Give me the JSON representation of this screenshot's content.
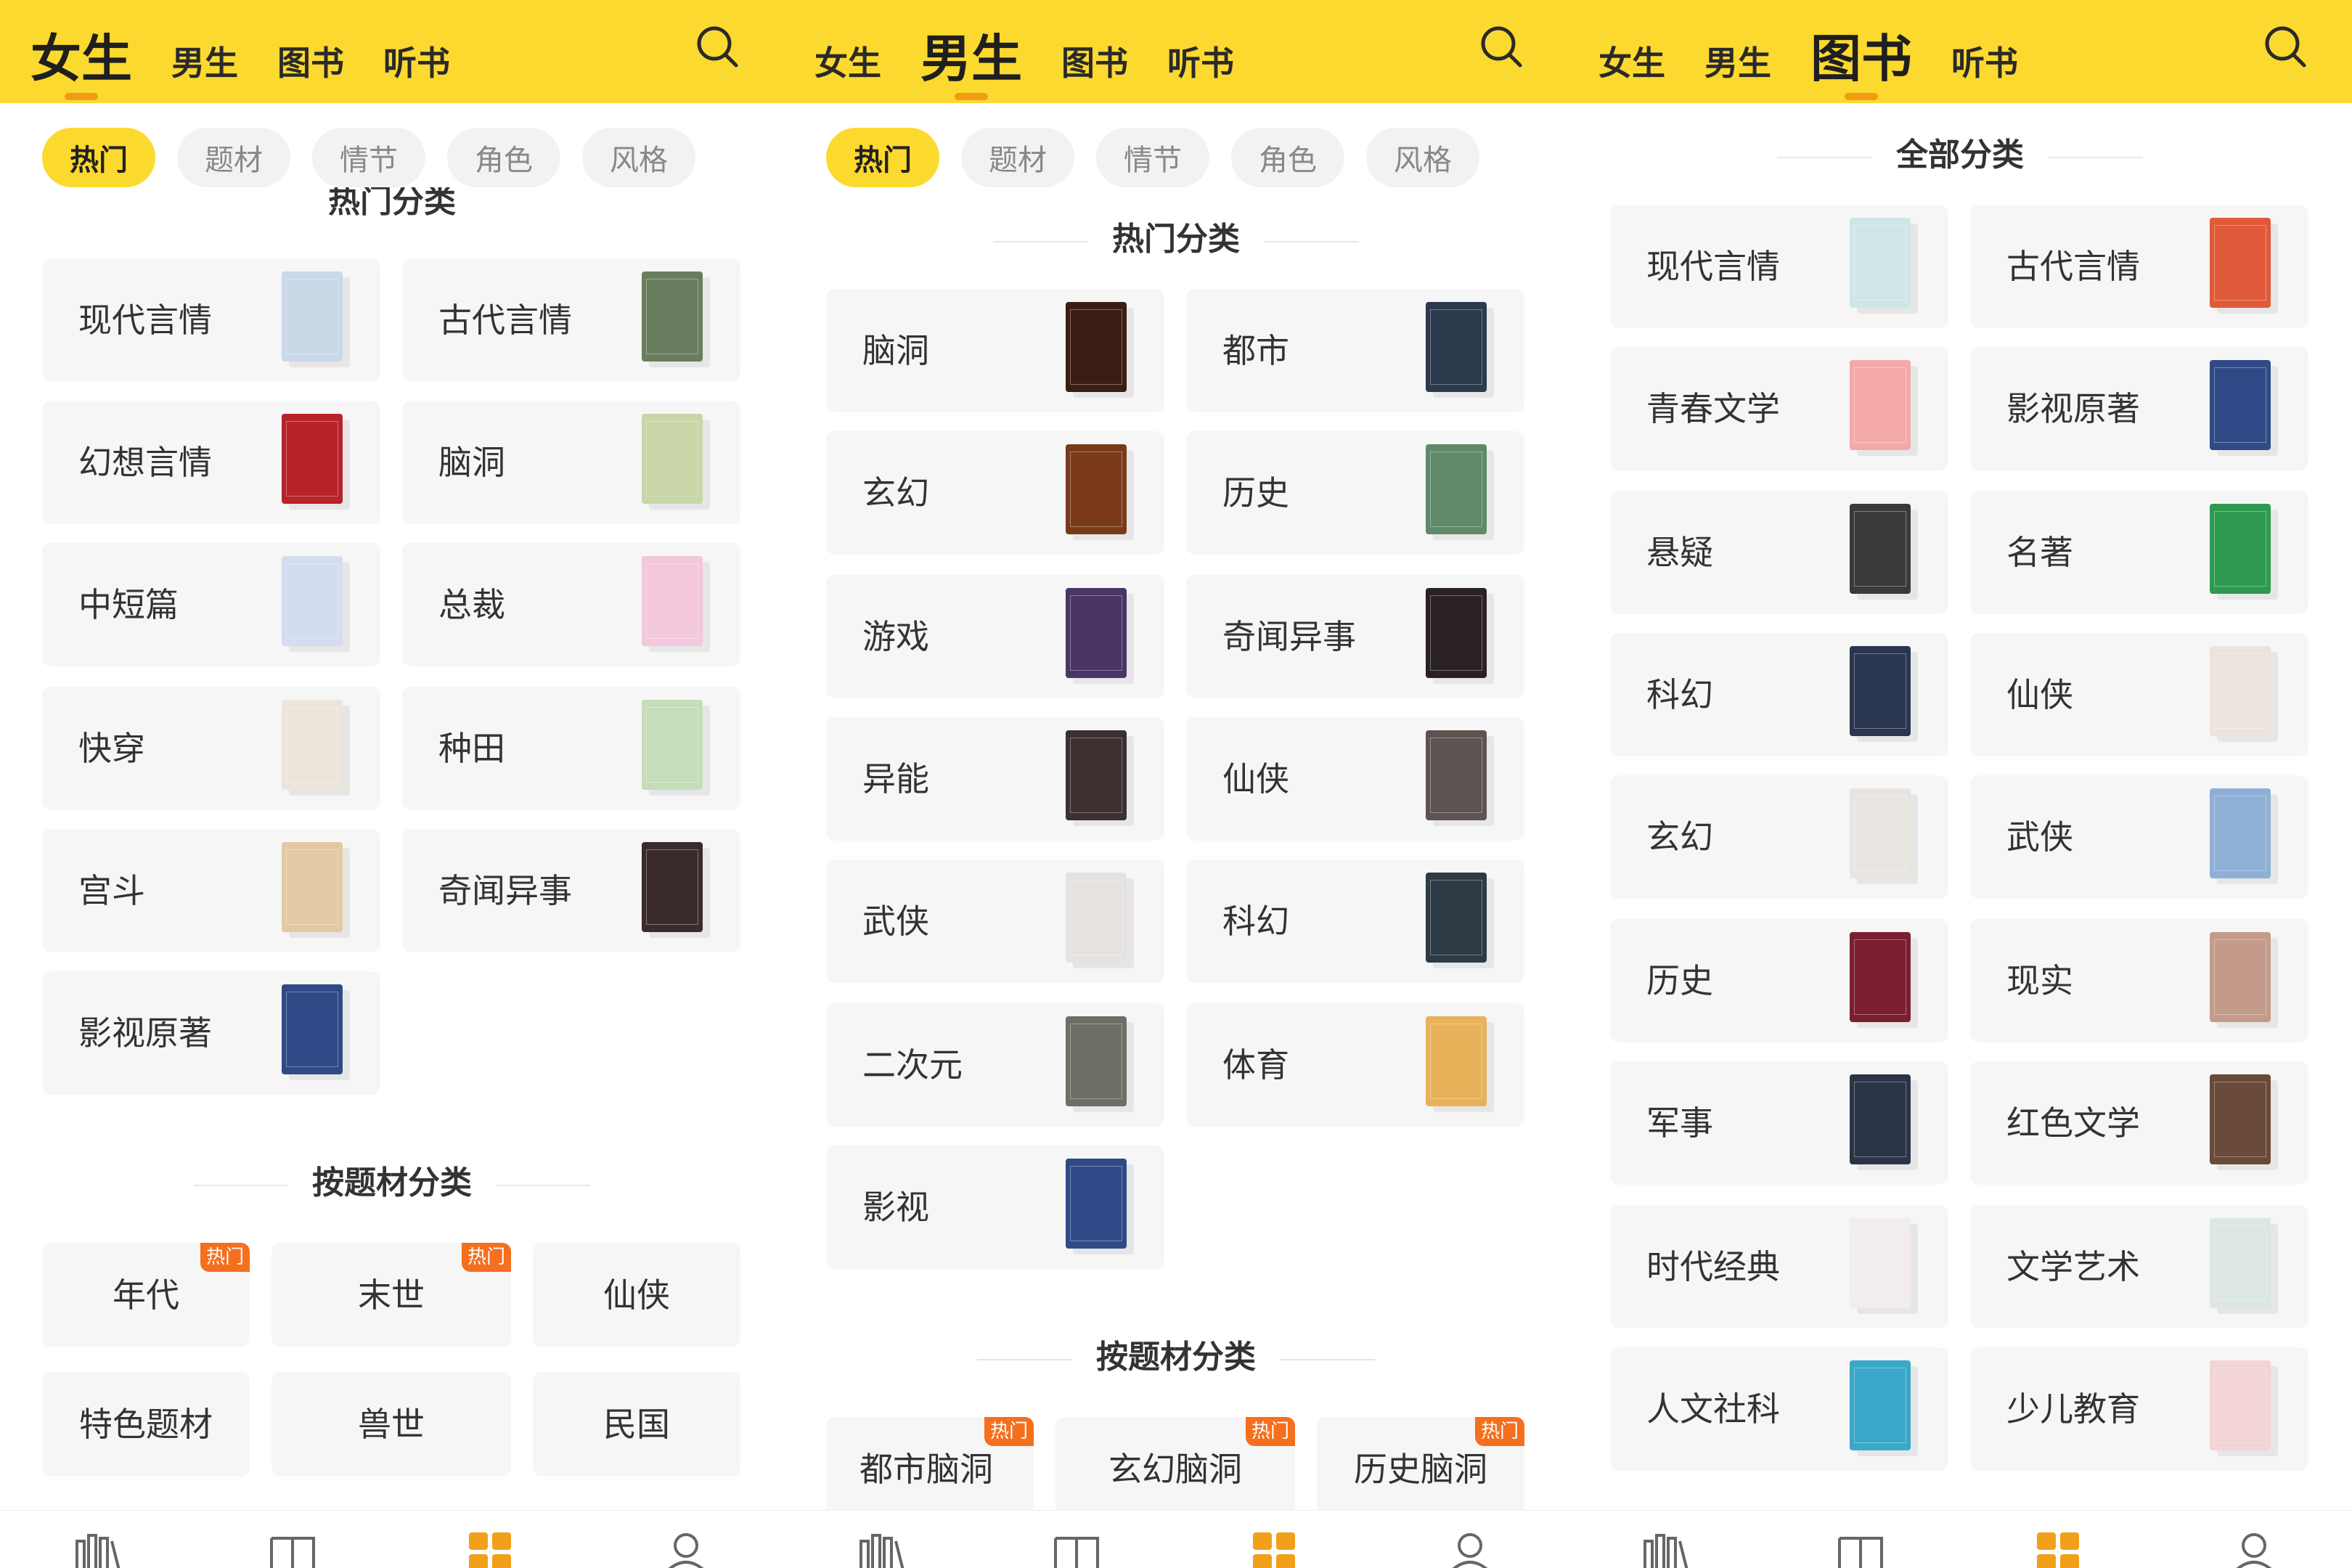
{
  "theme": {
    "accent": "#fcd92f",
    "hot_badge": "#f46f1e",
    "active_underline": "#f29a14"
  },
  "panels": [
    {
      "tabs": [
        {
          "label": "女生",
          "active": true
        },
        {
          "label": "男生",
          "active": false
        },
        {
          "label": "图书",
          "active": false
        },
        {
          "label": "听书",
          "active": false
        }
      ],
      "chips": [
        {
          "label": "热门",
          "active": true
        },
        {
          "label": "题材",
          "active": false
        },
        {
          "label": "情节",
          "active": false
        },
        {
          "label": "角色",
          "active": false
        },
        {
          "label": "风格",
          "active": false
        }
      ],
      "section1_title": "热门分类",
      "categories": [
        {
          "label": "现代言情",
          "cover": "#c9d9e8"
        },
        {
          "label": "古代言情",
          "cover": "#6a7d5e"
        },
        {
          "label": "幻想言情",
          "cover": "#b8232a"
        },
        {
          "label": "脑洞",
          "cover": "#c8d6a8"
        },
        {
          "label": "中短篇",
          "cover": "#d4dcf0"
        },
        {
          "label": "总裁",
          "cover": "#f3c7dc"
        },
        {
          "label": "快穿",
          "cover": "#ece6da"
        },
        {
          "label": "种田",
          "cover": "#c5ddb8"
        },
        {
          "label": "宫斗",
          "cover": "#e3c9a3"
        },
        {
          "label": "奇闻异事",
          "cover": "#3a2c2c"
        },
        {
          "label": "影视原著",
          "cover": "#2f4a86"
        }
      ],
      "section2_title": "按题材分类",
      "subjects": [
        {
          "label": "年代",
          "hot": "热门"
        },
        {
          "label": "末世",
          "hot": "热门"
        },
        {
          "label": "仙侠",
          "hot": ""
        },
        {
          "label": "特色题材",
          "hot": ""
        },
        {
          "label": "兽世",
          "hot": ""
        },
        {
          "label": "民国",
          "hot": ""
        }
      ]
    },
    {
      "tabs": [
        {
          "label": "女生",
          "active": false
        },
        {
          "label": "男生",
          "active": true
        },
        {
          "label": "图书",
          "active": false
        },
        {
          "label": "听书",
          "active": false
        }
      ],
      "chips": [
        {
          "label": "热门",
          "active": true
        },
        {
          "label": "题材",
          "active": false
        },
        {
          "label": "情节",
          "active": false
        },
        {
          "label": "角色",
          "active": false
        },
        {
          "label": "风格",
          "active": false
        }
      ],
      "section1_title": "热门分类",
      "categories": [
        {
          "label": "脑洞",
          "cover": "#3b1d14"
        },
        {
          "label": "都市",
          "cover": "#2b3a4d"
        },
        {
          "label": "玄幻",
          "cover": "#7a3a1a"
        },
        {
          "label": "历史",
          "cover": "#5e8a6a"
        },
        {
          "label": "游戏",
          "cover": "#4a3566"
        },
        {
          "label": "奇闻异事",
          "cover": "#2a2222"
        },
        {
          "label": "异能",
          "cover": "#3d3030"
        },
        {
          "label": "仙侠",
          "cover": "#5c5450"
        },
        {
          "label": "武侠",
          "cover": "#e6e2e0"
        },
        {
          "label": "科幻",
          "cover": "#2e3a44"
        },
        {
          "label": "二次元",
          "cover": "#6b6f64"
        },
        {
          "label": "体育",
          "cover": "#e8b25a"
        },
        {
          "label": "影视",
          "cover": "#2f4a86"
        }
      ],
      "section2_title": "按题材分类",
      "subjects": [
        {
          "label": "都市脑洞",
          "hot": "热门"
        },
        {
          "label": "玄幻脑洞",
          "hot": "热门"
        },
        {
          "label": "历史脑洞",
          "hot": "热门"
        }
      ]
    },
    {
      "tabs": [
        {
          "label": "女生",
          "active": false
        },
        {
          "label": "男生",
          "active": false
        },
        {
          "label": "图书",
          "active": true
        },
        {
          "label": "听书",
          "active": false
        }
      ],
      "chips": [],
      "section1_title": "全部分类",
      "categories": [
        {
          "label": "现代言情",
          "cover": "#cfe6e6"
        },
        {
          "label": "古代言情",
          "cover": "#e05a3a"
        },
        {
          "label": "青春文学",
          "cover": "#f4a9a8"
        },
        {
          "label": "影视原著",
          "cover": "#2f4a86"
        },
        {
          "label": "悬疑",
          "cover": "#3a3a3a"
        },
        {
          "label": "名著",
          "cover": "#2e9a50"
        },
        {
          "label": "科幻",
          "cover": "#2a3550"
        },
        {
          "label": "仙侠",
          "cover": "#ece4dc"
        },
        {
          "label": "玄幻",
          "cover": "#e8e4e0"
        },
        {
          "label": "武侠",
          "cover": "#8fb0d6"
        },
        {
          "label": "历史",
          "cover": "#7a1e30"
        },
        {
          "label": "现实",
          "cover": "#c49a8a"
        },
        {
          "label": "军事",
          "cover": "#2b3346"
        },
        {
          "label": "红色文学",
          "cover": "#6a4a38"
        },
        {
          "label": "时代经典",
          "cover": "#f2ecec"
        },
        {
          "label": "文学艺术",
          "cover": "#dce6e4"
        },
        {
          "label": "人文社科",
          "cover": "#3aa8c8"
        },
        {
          "label": "少儿教育",
          "cover": "#f2d4d4"
        }
      ],
      "section2_title": "",
      "subjects": []
    }
  ]
}
